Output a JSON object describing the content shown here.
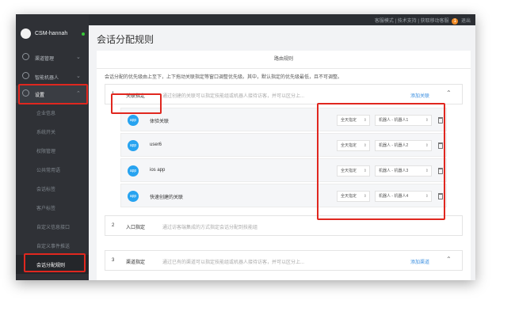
{
  "topbar": {
    "links": "客服模式 | 技术支持 | 获取移动客服",
    "notif": "1",
    "logout": "退出"
  },
  "user": {
    "name": "CSM-hannah"
  },
  "sidebar": {
    "items": [
      {
        "label": "渠道管理"
      },
      {
        "label": "智能机器人"
      },
      {
        "label": "设置"
      }
    ],
    "subitems": [
      {
        "label": "企业信息"
      },
      {
        "label": "系统开关"
      },
      {
        "label": "权限管理"
      },
      {
        "label": "公共常用语"
      },
      {
        "label": "会话标签"
      },
      {
        "label": "客户标签"
      },
      {
        "label": "自定义信息接口"
      },
      {
        "label": "自定义事件推送"
      },
      {
        "label": "会话分配规则"
      },
      {
        "label": "..."
      }
    ]
  },
  "page": {
    "title": "会话分配规则",
    "card_title": "路由规则",
    "description": "会话分配的优先级由上至下，上下拖动关联指定等窗口调整优先级。其中，默认指定的优先级最低，且不可调整。"
  },
  "sections": [
    {
      "num": "1",
      "name": "关联指定",
      "hint": "通过创建的关联可以指定技能组或机器人接待访客，并可以区分上...",
      "action": "添加关联"
    },
    {
      "num": "2",
      "name": "入口指定",
      "hint": "通过访客端集成的方式指定会话分配到技能组",
      "action": ""
    },
    {
      "num": "3",
      "name": "渠道指定",
      "hint": "通过已有的渠道可以指定技能组或机器人接待访客，并可以区分上...",
      "action": "添加渠道"
    }
  ],
  "rows": [
    {
      "icon": "app",
      "name": "体验关联",
      "mode": "全天指定",
      "robot": "机器人 - 机器人1"
    },
    {
      "icon": "app",
      "name": "user6",
      "mode": "全天指定",
      "robot": "机器人 - 机器人2"
    },
    {
      "icon": "app",
      "name": "ios app",
      "mode": "全天指定",
      "robot": "机器人 - 机器人3"
    },
    {
      "icon": "app",
      "name": "快速创建的关联",
      "mode": "全天指定",
      "robot": "机器人 - 机器人4"
    }
  ],
  "colors": {
    "accent": "#3b8fe0",
    "highlight": "#e0271f",
    "sidebar": "#2f3136",
    "app_icon": "#27a3f0"
  }
}
